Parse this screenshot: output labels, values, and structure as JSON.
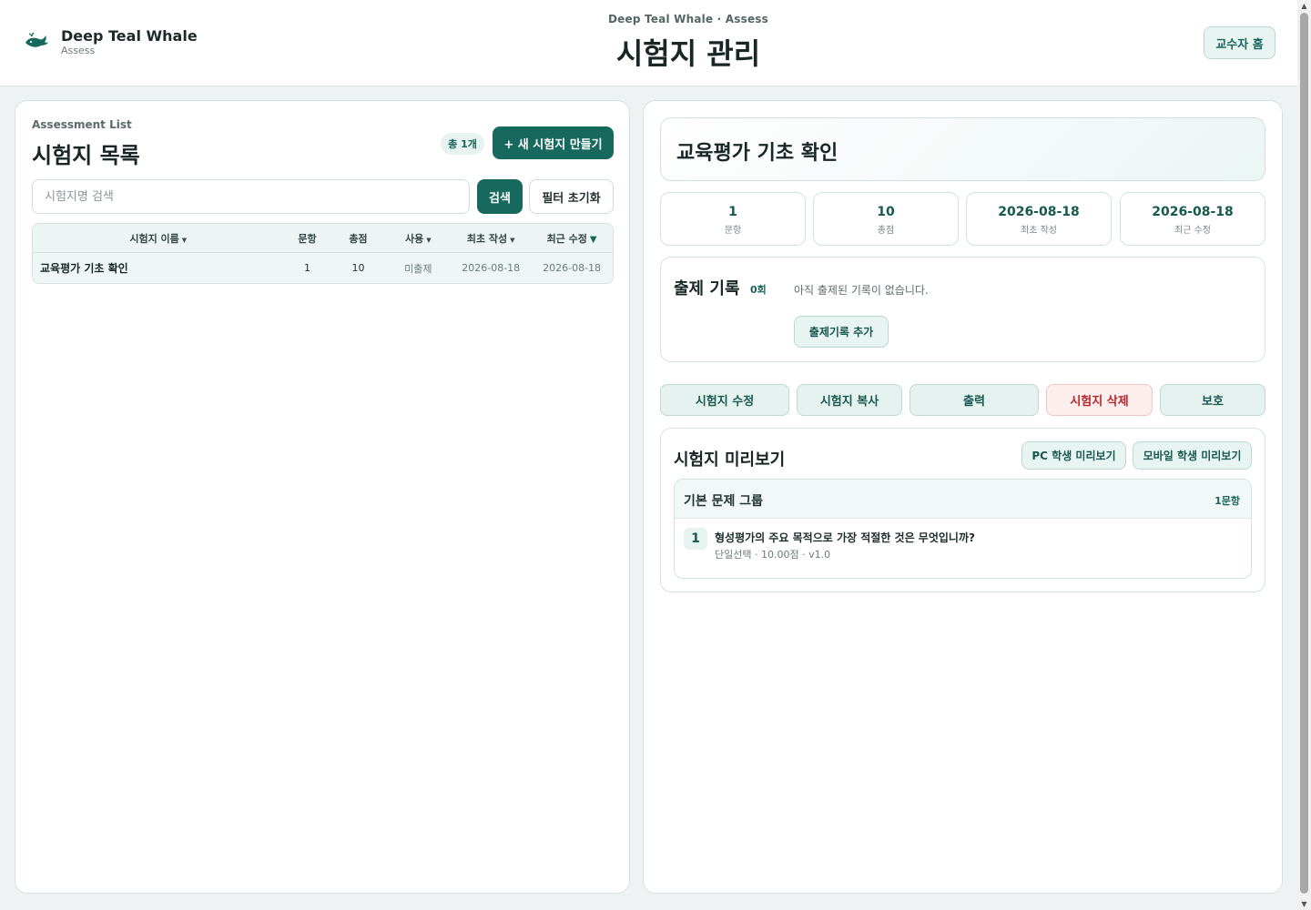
{
  "brand": {
    "name": "Deep Teal Whale",
    "sub": "Assess",
    "logo_icon": "whale-icon"
  },
  "header": {
    "kicker": "Deep Teal Whale · Assess",
    "title": "시험지 관리",
    "home_button": "교수자 홈"
  },
  "list": {
    "eyebrow": "Assessment List",
    "title": "시험지 목록",
    "count_badge": "총 1개",
    "new_button": "+ 새 시험지 만들기",
    "search": {
      "placeholder": "시험지명 검색",
      "value": ""
    },
    "search_button": "검색",
    "reset_button": "필터 초기화",
    "columns": [
      "시험지 이름",
      "문항",
      "총점",
      "사용",
      "최초 작성",
      "최근 수정"
    ],
    "active_sort": "최근 수정",
    "rows": [
      {
        "name": "교육평가 기초 확인",
        "items": "1",
        "score": "10",
        "usage": "미출제",
        "created": "2026-08-18",
        "updated": "2026-08-18"
      }
    ]
  },
  "detail": {
    "title": "교육평가 기초 확인",
    "stats": [
      {
        "value": "1",
        "label": "문항"
      },
      {
        "value": "10",
        "label": "총점"
      },
      {
        "value": "2026-08-18",
        "label": "최초 작성"
      },
      {
        "value": "2026-08-18",
        "label": "최근 수정"
      }
    ],
    "history": {
      "title": "출제 기록",
      "count": "0회",
      "empty": "아직 출제된 기록이 없습니다.",
      "add_button": "출제기록 추가"
    },
    "actions": [
      "시험지 수정",
      "시험지 복사",
      "출력",
      "시험지 삭제",
      "보호"
    ],
    "preview": {
      "title": "시험지 미리보기",
      "pc_button": "PC 학생 미리보기",
      "mobile_button": "모바일 학생 미리보기",
      "group": {
        "title": "기본 문제 그룹",
        "count": "1문항",
        "questions": [
          {
            "number": "1",
            "text": "형성평가의 주요 목적으로 가장 적절한 것은 무엇입니까?",
            "meta": "단일선택 · 10.00점 · v1.0"
          }
        ]
      }
    }
  },
  "colors": {
    "accent": "#17695e",
    "danger": "#b3282d",
    "page_bg": "#eef2f2"
  }
}
